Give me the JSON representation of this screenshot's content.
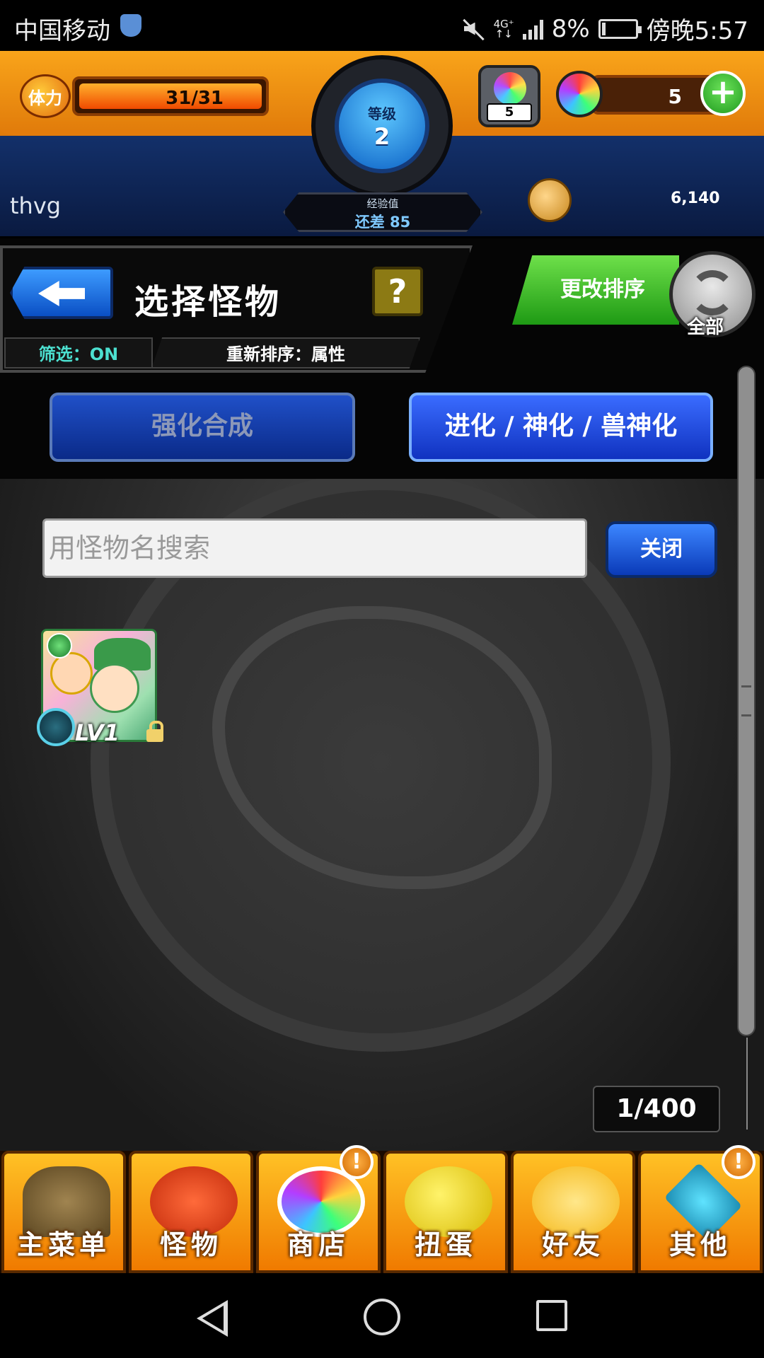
{
  "status_bar": {
    "carrier": "中国移动",
    "network_type_top": "4G⁺",
    "network_type_bottom": "↑↓",
    "battery": "8%",
    "time": "傍晚5:57"
  },
  "hud": {
    "stamina_icon_label": "体力",
    "stamina": "31/31",
    "level_label": "等级",
    "level": "2",
    "exp_label": "经验值",
    "exp_remaining": "还差 85",
    "stamina_box_count": "5",
    "orbs": "5",
    "username": "thvg",
    "coins": "6,140"
  },
  "header": {
    "title": "选择怪物",
    "help": "?",
    "filter": "筛选：ON",
    "sort": "重新排序：属性",
    "change_sort": "更改排序",
    "refresh_label": "全部"
  },
  "tabs": {
    "enhance": "强化合成",
    "evolve": "进化 / 神化 / 兽神化"
  },
  "search": {
    "placeholder": "用怪物名搜索",
    "value": "",
    "close": "关闭"
  },
  "monsters": [
    {
      "level": "LV1",
      "element_icon": "wood-element-icon",
      "locked": true
    }
  ],
  "box_count": "1/400",
  "bottom_nav": [
    {
      "label": "主菜单",
      "icon": "gate-icon"
    },
    {
      "label": "怪物",
      "icon": "monster-icon"
    },
    {
      "label": "商店",
      "icon": "orb-icon",
      "badge": "!"
    },
    {
      "label": "扭蛋",
      "icon": "egg-icon"
    },
    {
      "label": "好友",
      "icon": "friends-icon"
    },
    {
      "label": "其他",
      "icon": "other-icon",
      "badge": "!"
    }
  ],
  "colors": {
    "hud_orange": "#f9a41a",
    "hud_blue": "#13306a",
    "accent_green": "#1e9a14",
    "tab_blue": "#1032c0"
  }
}
